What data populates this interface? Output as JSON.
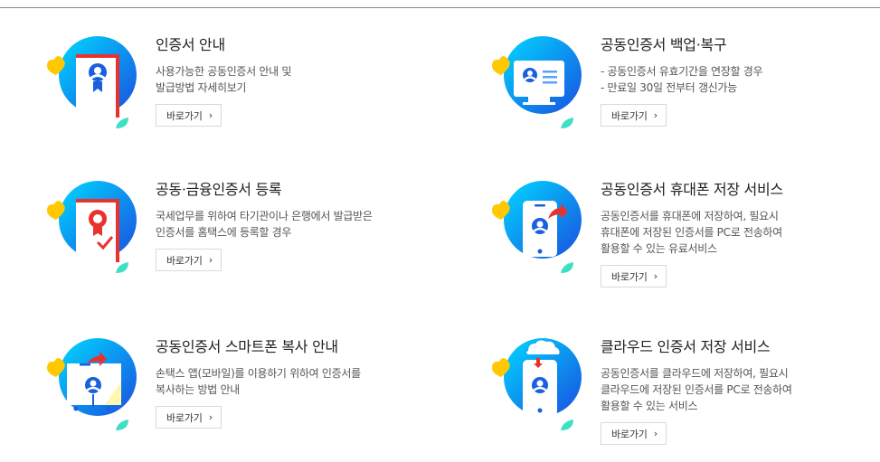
{
  "services": [
    {
      "title": "인증서 안내",
      "desc": [
        "사용가능한 공동인증서 안내 및",
        "발급방법 자세히보기"
      ],
      "button": "바로가기",
      "icon": "certificate-document-icon"
    },
    {
      "title": "공동인증서 백업·복구",
      "desc": [
        "- 공동인증서 유효기간을 연장할 경우",
        "- 만료일 30일 전부터 갱신가능"
      ],
      "button": "바로가기",
      "icon": "monitor-certificate-icon"
    },
    {
      "title": "공동·금융인증서 등록",
      "desc": [
        "국세업무를 위하여 타기관이나 은행에서 발급받은",
        "인증서를 홈택스에 등록할 경우"
      ],
      "button": "바로가기",
      "icon": "register-certificate-icon"
    },
    {
      "title": "공동인증서 휴대폰 저장 서비스",
      "desc": [
        "공동인증서를 휴대폰에 저장하여, 필요시",
        "휴대폰에 저장된 인증서를 PC로 전송하여",
        "활용할 수 있는 유료서비스"
      ],
      "button": "바로가기",
      "icon": "phone-certificate-icon"
    },
    {
      "title": "공동인증서 스마트폰 복사 안내",
      "desc": [
        "손택스 앱(모바일)를 이용하기 위하여 인증서를",
        "복사하는 방법 안내"
      ],
      "button": "바로가기",
      "icon": "smartphone-copy-icon"
    },
    {
      "title": "클라우드 인증서 저장 서비스",
      "desc": [
        "공동인증서를 클라우드에 저장하여, 필요시",
        "클라우드에 저장된 인증서를 PC로 전송하여",
        "활용할 수 있는 서비스"
      ],
      "button": "바로가기",
      "icon": "cloud-certificate-icon"
    }
  ],
  "chevron": "›",
  "colors": {
    "circle_light": "#00d2ff",
    "circle_dark": "#1a4fe0",
    "yellow": "#ffc800",
    "mint": "#3ee0c4",
    "red": "#e8322e"
  }
}
